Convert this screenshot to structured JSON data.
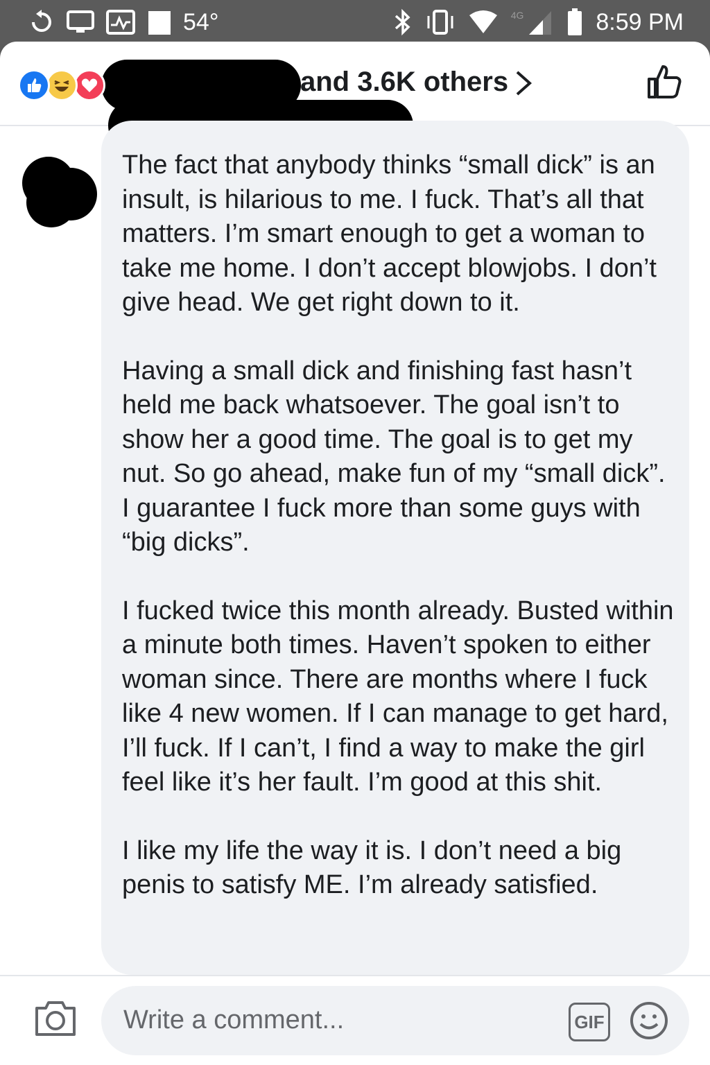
{
  "status_bar": {
    "temperature": "54°",
    "time": "8:59 PM",
    "network_label": "4G"
  },
  "reactions": {
    "others_text": "and 3.6K others",
    "types": [
      "like-icon",
      "haha-icon",
      "love-icon"
    ]
  },
  "comment": {
    "paragraphs": [
      "The fact that anybody thinks “small dick” is an insult, is hilarious to me. I fuck. That’s all that matters. I’m smart enough to get a woman to take me home. I don’t accept blowjobs. I don’t give head. We get right down to it.",
      "Having a small dick and finishing fast hasn’t held me back whatsoever. The goal isn’t to show her a good time. The goal is to get my nut. So go ahead, make fun of my “small dick”. I guarantee I fuck more than some guys with “big dicks”.",
      "I fucked twice this month already. Busted within a minute both times. Haven’t spoken to either woman since. There are months where I fuck like 4 new women. If I can manage to get hard, I’ll fuck. If I can’t, I find a way to make the girl feel like it’s her fault. I’m good at this shit.",
      "I like my life the way it is. I don’t need a big penis to satisfy ME. I’m already satisfied."
    ]
  },
  "composer": {
    "placeholder": "Write a comment...",
    "gif_label": "GIF"
  },
  "colors": {
    "like": "#1877f2",
    "haha": "#f7c948",
    "love": "#f33e58",
    "bubble": "#f0f2f5",
    "status_bar": "#5b5b5b"
  }
}
